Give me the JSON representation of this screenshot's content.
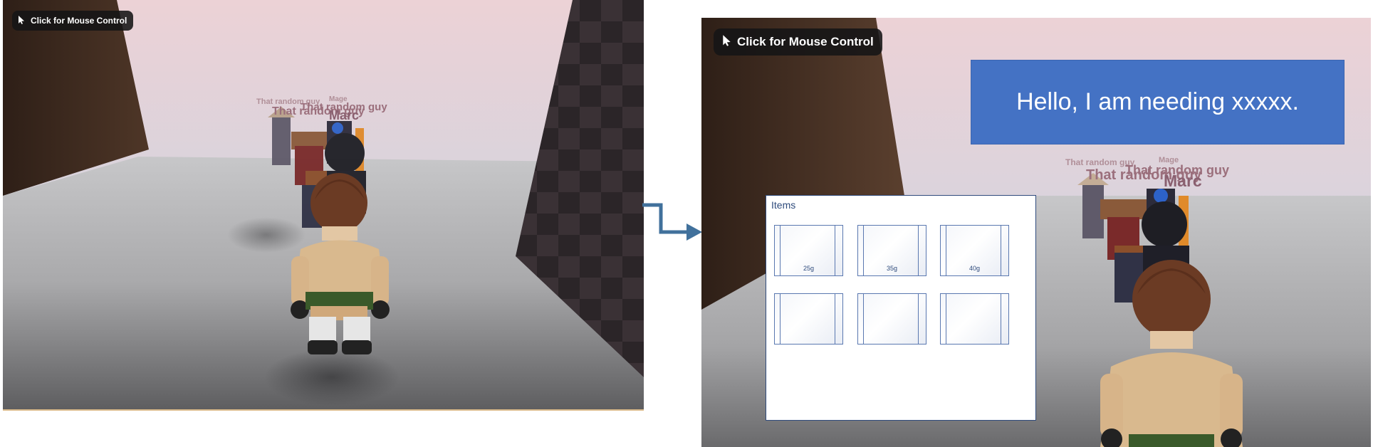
{
  "mouse_control_label": "Click for Mouse Control",
  "nametags": {
    "tag_a": "That random guy",
    "tag_b": "That random guy",
    "tag_c": "Mage",
    "tag_d": "That random guy",
    "tag_e": "Marc"
  },
  "speech_text": "Hello, I am needing xxxxx.",
  "items_panel": {
    "title": "Items",
    "slots": [
      {
        "price": "25g"
      },
      {
        "price": "35g"
      },
      {
        "price": "40g"
      },
      {
        "price": ""
      },
      {
        "price": ""
      },
      {
        "price": ""
      }
    ]
  },
  "colors": {
    "speech_bg": "#4472c4",
    "panel_border": "#2f4b7c",
    "arrow": "#41719c",
    "nametag": "#9b6f7c"
  },
  "icons": [
    "cursor-icon",
    "arrow-icon"
  ]
}
